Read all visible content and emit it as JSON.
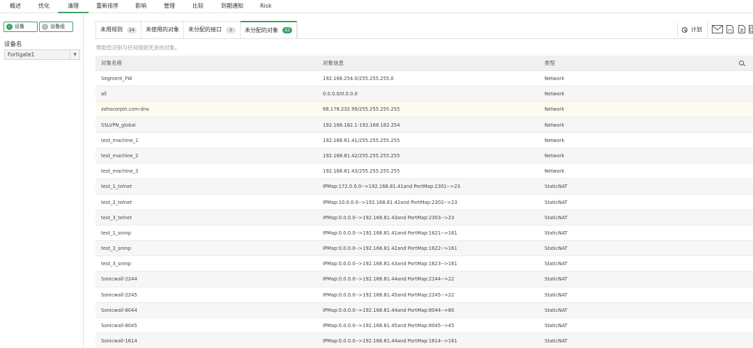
{
  "nav": {
    "items": [
      "概述",
      "优化",
      "清理",
      "重新排序",
      "影响",
      "管理",
      "比较",
      "到期通知",
      "Risk"
    ],
    "active_index": 2
  },
  "sidebar": {
    "device_pill": "设备",
    "device_group_pill": "设备组",
    "device_name_label": "设备名",
    "device_select_value": "Fortigate1"
  },
  "tabs": [
    {
      "label": "未用规则",
      "count": "24"
    },
    {
      "label": "未使用的对象",
      "count": ""
    },
    {
      "label": "未分配的接口",
      "count": "2"
    },
    {
      "label": "未分配的对象",
      "count": "22",
      "active": true
    }
  ],
  "toolbar": {
    "schedule_label": "计划"
  },
  "hint": "帮助您识别与任何规则无关的对象。",
  "table": {
    "headers": [
      "对象名称",
      "对象信息",
      "类型"
    ],
    "rows": [
      [
        "Segment_FW",
        "192.168.254.0/255.255.255.0",
        "Network"
      ],
      [
        "all",
        "0.0.0.0/0.0.0.0",
        "Network"
      ],
      [
        "zohocorpin.com-dns",
        "68.178.232.99/255.255.255.255",
        "Network"
      ],
      [
        "SSLVPN_global",
        "192.168.182.1-192.168.182.254",
        "Network"
      ],
      [
        "test_machine_1",
        "192.168.81.41/255.255.255.255",
        "Network"
      ],
      [
        "test_machine_2",
        "192.168.81.42/255.255.255.255",
        "Network"
      ],
      [
        "test_machine_3",
        "192.168.81.43/255.255.255.255",
        "Network"
      ],
      [
        "test_1_telnet",
        "IPMap:172.0.0.0-->192.168.81.41and PortMap:2301-->23",
        "StaticNAT"
      ],
      [
        "test_2_telnet",
        "IPMap:10.0.0.0-->192.168.81.42and PortMap:2302-->23",
        "StaticNAT"
      ],
      [
        "test_3_telnet",
        "IPMap:0.0.0.0-->192.168.81.43and PortMap:2303-->23",
        "StaticNAT"
      ],
      [
        "test_1_snmp",
        "IPMap:0.0.0.0-->192.168.81.41and PortMap:1621-->161",
        "StaticNAT"
      ],
      [
        "test_2_snmp",
        "IPMap:0.0.0.0-->192.168.81.42and PortMap:1622-->161",
        "StaticNAT"
      ],
      [
        "test_3_snmp",
        "IPMap:0.0.0.0-->192.168.81.43and PortMap:1623-->161",
        "StaticNAT"
      ],
      [
        "Sonicwall-2244",
        "IPMap:0.0.0.0-->192.168.81.44and PortMap:2244-->22",
        "StaticNAT"
      ],
      [
        "Sonicwall-2245",
        "IPMap:0.0.0.0-->192.168.81.45and PortMap:2245-->22",
        "StaticNAT"
      ],
      [
        "Sonicwall-8044",
        "IPMap:0.0.0.0-->192.168.81.44and PortMap:8044-->80",
        "StaticNAT"
      ],
      [
        "Sonicwall-8045",
        "IPMap:0.0.0.0-->192.168.81.45and PortMap:8045-->45",
        "StaticNAT"
      ],
      [
        "Sonicwall-1614",
        "IPMap:0.0.0.0-->192.168.81.44and PortMap:1614-->161",
        "StaticNAT"
      ]
    ],
    "highlight_index": 2
  },
  "colors": {
    "accent": "#3aa163",
    "highlight_row": "#fdfbee"
  }
}
